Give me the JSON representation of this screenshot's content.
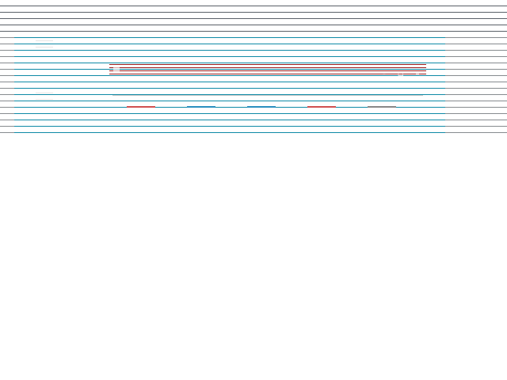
{
  "taskbar": {
    "title": ""
  },
  "desktop": {
    "icons": [
      {
        "label": "",
        "icon": "folder-icon"
      },
      {
        "label": "",
        "icon": "computer-icon"
      }
    ]
  },
  "window": {
    "title": "",
    "info": "",
    "cards": [
      {
        "label": "",
        "bar_color": "#d05050"
      },
      {
        "label": "",
        "bar_color": "#2a8fc0"
      },
      {
        "label": "",
        "bar_color": "#2a8fc0"
      },
      {
        "label": "",
        "bar_color": "#d05050"
      },
      {
        "label": "",
        "bar_color": "#888888"
      }
    ],
    "status": ""
  },
  "colors": {
    "desktop": "#0f8aa6",
    "titlebar": "#9a1d1d",
    "window": "#ffffff"
  }
}
